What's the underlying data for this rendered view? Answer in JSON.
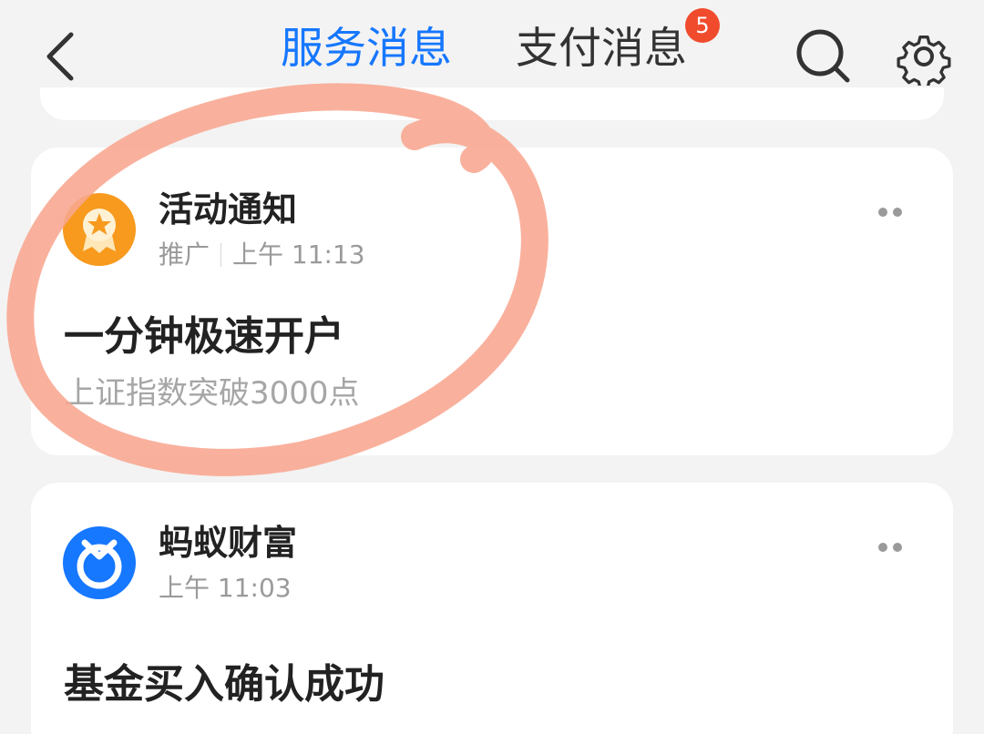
{
  "header": {
    "tabs": [
      {
        "label": "服务消息",
        "active": true
      },
      {
        "label": "支付消息",
        "active": false,
        "badge": "5"
      }
    ],
    "icons": [
      "chevron-left-icon",
      "search-icon",
      "gear-icon"
    ],
    "accent_color": "#1677ff",
    "badge_color": "#f04b2d"
  },
  "messages": [
    {
      "sender": "活动通知",
      "tag": "推广",
      "time": "上午 11:13",
      "title": "一分钟极速开户",
      "subtitle": "上证指数突破3000点",
      "avatar_icon": "medal-star-icon",
      "avatar_color": "#f79a1e"
    },
    {
      "sender": "蚂蚁财富",
      "time": "上午 11:03",
      "title": "基金买入确认成功",
      "avatar_icon": "ant-fortune-logo-icon",
      "avatar_color": "#1677ff"
    }
  ],
  "annotation": {
    "shape": "hand-drawn-circle",
    "color": "#f8a68f"
  }
}
